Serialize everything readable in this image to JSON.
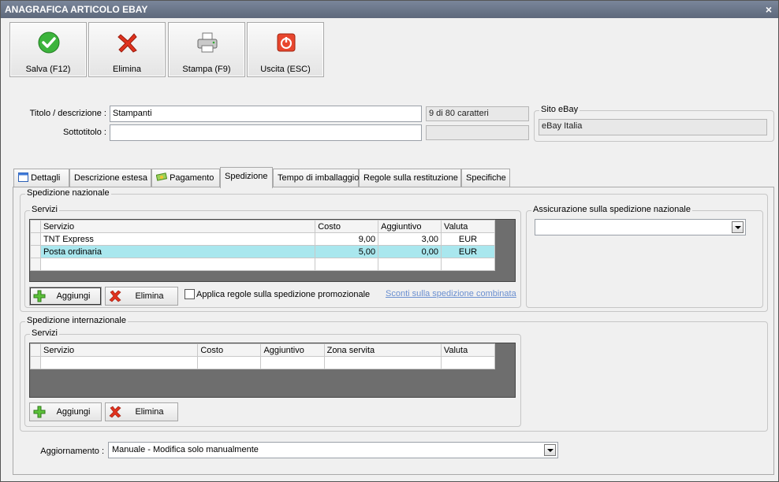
{
  "window": {
    "title": "ANAGRAFICA ARTICOLO EBAY",
    "close_glyph": "×"
  },
  "toolbar": {
    "buttons": [
      {
        "label": "Salva (F12)",
        "icon": "check-icon"
      },
      {
        "label": "Elimina",
        "icon": "delete-x-icon"
      },
      {
        "label": "Stampa (F9)",
        "icon": "printer-icon"
      },
      {
        "label": "Uscita (ESC)",
        "icon": "power-icon"
      }
    ]
  },
  "header": {
    "title_label": "Titolo / descrizione :",
    "title_value": "Stampanti",
    "title_counter": "9 di 80 caratteri",
    "subtitle_label": "Sottotitolo :",
    "subtitle_value": "",
    "site_legend": "Sito eBay",
    "site_value": "eBay Italia"
  },
  "tabs": [
    {
      "label": "Dettagli",
      "icon": "calendar-icon"
    },
    {
      "label": "Descrizione estesa"
    },
    {
      "label": "Pagamento",
      "icon": "money-icon"
    },
    {
      "label": "Spedizione",
      "active": true
    },
    {
      "label": "Tempo di imballaggio"
    },
    {
      "label": "Regole sulla restituzione"
    },
    {
      "label": "Specifiche"
    }
  ],
  "national": {
    "legend": "Spedizione nazionale",
    "services_legend": "Servizi",
    "columns": [
      "Servizio",
      "Costo",
      "Aggiuntivo",
      "Valuta"
    ],
    "rows": [
      {
        "servizio": "TNT Express",
        "costo": "9,00",
        "aggiuntivo": "3,00",
        "valuta": "EUR"
      },
      {
        "servizio": "Posta ordinaria",
        "costo": "5,00",
        "aggiuntivo": "0,00",
        "valuta": "EUR"
      }
    ],
    "add_label": "Aggiungi",
    "delete_label": "Elimina",
    "promo_checkbox_label": "Applica regole sulla spedizione promozionale",
    "combined_link": "Sconti sulla spedizione combinata",
    "insurance_legend": "Assicurazione sulla spedizione nazionale",
    "insurance_value": ""
  },
  "international": {
    "legend": "Spedizione internazionale",
    "services_legend": "Servizi",
    "columns": [
      "Servizio",
      "Costo",
      "Aggiuntivo",
      "Zona servita",
      "Valuta"
    ],
    "add_label": "Aggiungi",
    "delete_label": "Elimina"
  },
  "footer": {
    "update_label": "Aggiornamento :",
    "update_value": "Manuale - Modifica solo manualmente"
  }
}
